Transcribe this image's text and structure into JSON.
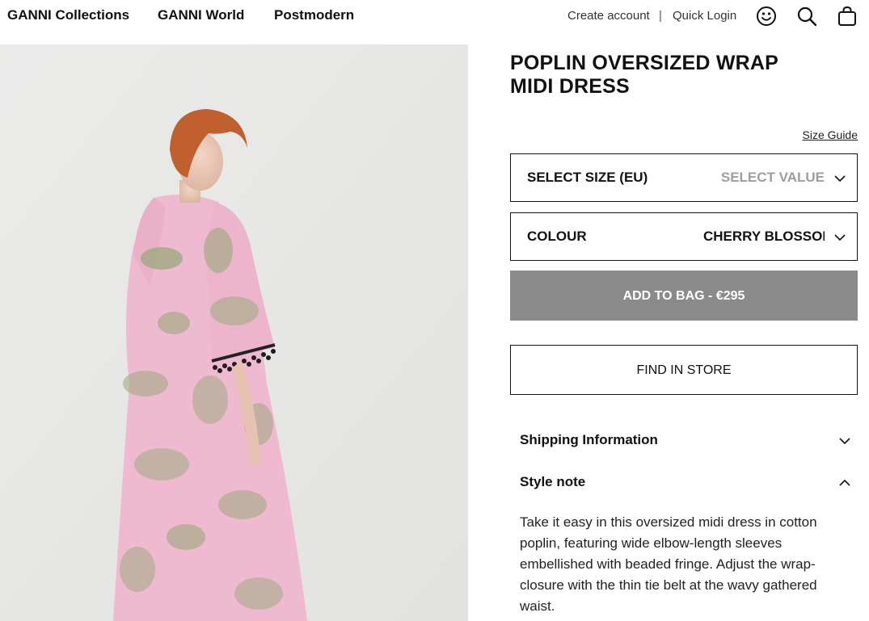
{
  "header": {
    "nav": [
      "GANNI Collections",
      "GANNI World",
      "Postmodern"
    ],
    "create_account": "Create account",
    "separator": "|",
    "quick_login": "Quick Login",
    "icons": [
      "smiley-icon",
      "search-icon",
      "bag-icon"
    ]
  },
  "product": {
    "title_line1": "POPLIN OVERSIZED WRAP",
    "title_line2": "MIDI DRESS",
    "size_guide": "Size Guide",
    "size": {
      "label": "SELECT SIZE (EU)",
      "value": "SELECT VALUE"
    },
    "colour": {
      "label": "COLOUR",
      "value": "CHERRY BLOSSOM"
    },
    "add_to_bag": "ADD TO BAG - €295",
    "find_in_store": "FIND IN STORE"
  },
  "accordions": [
    {
      "label": "Shipping Information",
      "expanded": false
    },
    {
      "label": "Style note",
      "expanded": true
    }
  ],
  "style_note": "Take it easy in this oversized midi dress in cotton poplin, featuring wide elbow-length sleeves embellished with beaded fringe. Adjust the wrap-closure with the thin tie belt at the wavy gathered waist.",
  "colors": {
    "button_disabled": "#8a8a8a",
    "dress_pink": "#efb9d0",
    "dress_green": "#9aaa7a",
    "hair": "#c0602e",
    "background": "#e7e7e5"
  }
}
